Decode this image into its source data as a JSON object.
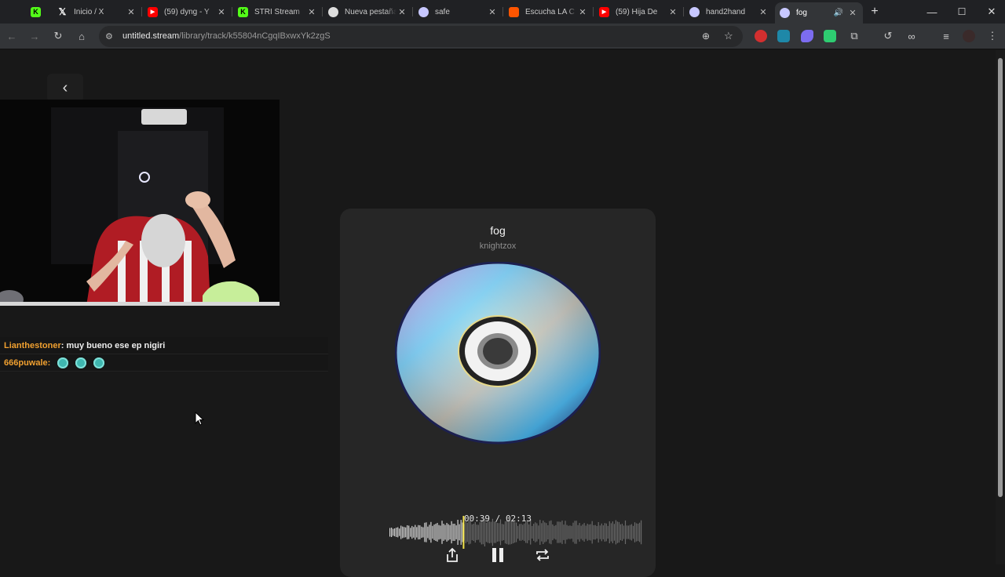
{
  "browser": {
    "tabs": [
      {
        "title": "",
        "icon": "kick-icon",
        "color": "#53fc18"
      },
      {
        "title": "Inicio / X",
        "icon": "x-icon",
        "color": "#ffffff"
      },
      {
        "title": "(59) dyng - Y",
        "icon": "youtube-icon",
        "color": "#ff0000"
      },
      {
        "title": "STRI Stream",
        "icon": "kick-icon",
        "color": "#53fc18"
      },
      {
        "title": "Nueva pestaña",
        "icon": "chrome-icon",
        "color": "#ffffff"
      },
      {
        "title": "safe",
        "icon": "untitled-icon",
        "color": "#c7c7ff"
      },
      {
        "title": "Escucha LA C",
        "icon": "soundcloud-icon",
        "color": "#ff5500"
      },
      {
        "title": "(59) Hija De",
        "icon": "youtube-icon",
        "color": "#ff0000"
      },
      {
        "title": "hand2hand",
        "icon": "untitled-icon",
        "color": "#c7c7ff"
      },
      {
        "title": "fog",
        "icon": "untitled-icon",
        "color": "#c7c7ff"
      }
    ],
    "url_host": "untitled.stream",
    "url_path": "/library/track/k55804nCgqIBxwxYk2zgS"
  },
  "chat": {
    "messages": [
      {
        "user": "Lianthestoner",
        "text": " : muy bueno ese ep nigiri"
      },
      {
        "user": "666puwale",
        "text": " :"
      }
    ]
  },
  "player": {
    "title": "fog",
    "artist": "knightzox",
    "elapsed": "00:39",
    "separator": " / ",
    "duration": "02:13",
    "progress": 0.29
  }
}
